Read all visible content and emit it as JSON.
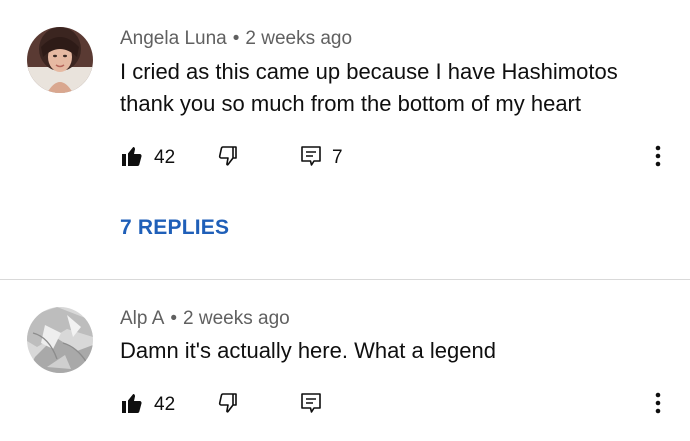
{
  "comments": [
    {
      "author": "Angela Luna",
      "separator": "•",
      "time": "2 weeks ago",
      "text": "I cried as this came up because I have Hashimotos thank you so much from the bottom of my heart",
      "likes": "42",
      "replies_count": "7",
      "replies_link": "7 REPLIES",
      "icons": [
        "thumbs-up-filled",
        "thumbs-down-outline",
        "reply-comment",
        "more-vertical"
      ]
    },
    {
      "author": "Alp A",
      "separator": "•",
      "time": "2 weeks ago",
      "text": "Damn it's actually here. What a legend",
      "likes": "42",
      "icons": [
        "thumbs-up-filled",
        "thumbs-down-outline",
        "reply-comment",
        "more-vertical"
      ]
    }
  ],
  "colors": {
    "link": "#1f5fb8",
    "meta": "#606060",
    "divider": "#d9d9d9"
  }
}
